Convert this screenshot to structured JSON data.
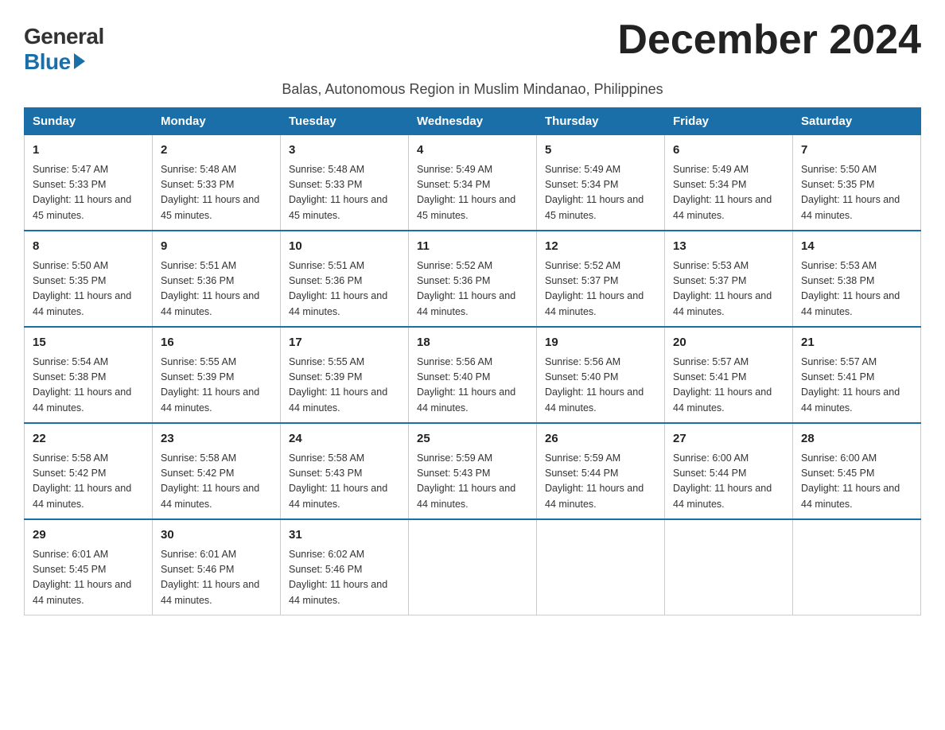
{
  "logo": {
    "general": "General",
    "blue": "Blue"
  },
  "title": "December 2024",
  "subtitle": "Balas, Autonomous Region in Muslim Mindanao, Philippines",
  "headers": [
    "Sunday",
    "Monday",
    "Tuesday",
    "Wednesday",
    "Thursday",
    "Friday",
    "Saturday"
  ],
  "weeks": [
    [
      {
        "day": "1",
        "sunrise": "5:47 AM",
        "sunset": "5:33 PM",
        "daylight": "11 hours and 45 minutes."
      },
      {
        "day": "2",
        "sunrise": "5:48 AM",
        "sunset": "5:33 PM",
        "daylight": "11 hours and 45 minutes."
      },
      {
        "day": "3",
        "sunrise": "5:48 AM",
        "sunset": "5:33 PM",
        "daylight": "11 hours and 45 minutes."
      },
      {
        "day": "4",
        "sunrise": "5:49 AM",
        "sunset": "5:34 PM",
        "daylight": "11 hours and 45 minutes."
      },
      {
        "day": "5",
        "sunrise": "5:49 AM",
        "sunset": "5:34 PM",
        "daylight": "11 hours and 45 minutes."
      },
      {
        "day": "6",
        "sunrise": "5:49 AM",
        "sunset": "5:34 PM",
        "daylight": "11 hours and 44 minutes."
      },
      {
        "day": "7",
        "sunrise": "5:50 AM",
        "sunset": "5:35 PM",
        "daylight": "11 hours and 44 minutes."
      }
    ],
    [
      {
        "day": "8",
        "sunrise": "5:50 AM",
        "sunset": "5:35 PM",
        "daylight": "11 hours and 44 minutes."
      },
      {
        "day": "9",
        "sunrise": "5:51 AM",
        "sunset": "5:36 PM",
        "daylight": "11 hours and 44 minutes."
      },
      {
        "day": "10",
        "sunrise": "5:51 AM",
        "sunset": "5:36 PM",
        "daylight": "11 hours and 44 minutes."
      },
      {
        "day": "11",
        "sunrise": "5:52 AM",
        "sunset": "5:36 PM",
        "daylight": "11 hours and 44 minutes."
      },
      {
        "day": "12",
        "sunrise": "5:52 AM",
        "sunset": "5:37 PM",
        "daylight": "11 hours and 44 minutes."
      },
      {
        "day": "13",
        "sunrise": "5:53 AM",
        "sunset": "5:37 PM",
        "daylight": "11 hours and 44 minutes."
      },
      {
        "day": "14",
        "sunrise": "5:53 AM",
        "sunset": "5:38 PM",
        "daylight": "11 hours and 44 minutes."
      }
    ],
    [
      {
        "day": "15",
        "sunrise": "5:54 AM",
        "sunset": "5:38 PM",
        "daylight": "11 hours and 44 minutes."
      },
      {
        "day": "16",
        "sunrise": "5:55 AM",
        "sunset": "5:39 PM",
        "daylight": "11 hours and 44 minutes."
      },
      {
        "day": "17",
        "sunrise": "5:55 AM",
        "sunset": "5:39 PM",
        "daylight": "11 hours and 44 minutes."
      },
      {
        "day": "18",
        "sunrise": "5:56 AM",
        "sunset": "5:40 PM",
        "daylight": "11 hours and 44 minutes."
      },
      {
        "day": "19",
        "sunrise": "5:56 AM",
        "sunset": "5:40 PM",
        "daylight": "11 hours and 44 minutes."
      },
      {
        "day": "20",
        "sunrise": "5:57 AM",
        "sunset": "5:41 PM",
        "daylight": "11 hours and 44 minutes."
      },
      {
        "day": "21",
        "sunrise": "5:57 AM",
        "sunset": "5:41 PM",
        "daylight": "11 hours and 44 minutes."
      }
    ],
    [
      {
        "day": "22",
        "sunrise": "5:58 AM",
        "sunset": "5:42 PM",
        "daylight": "11 hours and 44 minutes."
      },
      {
        "day": "23",
        "sunrise": "5:58 AM",
        "sunset": "5:42 PM",
        "daylight": "11 hours and 44 minutes."
      },
      {
        "day": "24",
        "sunrise": "5:58 AM",
        "sunset": "5:43 PM",
        "daylight": "11 hours and 44 minutes."
      },
      {
        "day": "25",
        "sunrise": "5:59 AM",
        "sunset": "5:43 PM",
        "daylight": "11 hours and 44 minutes."
      },
      {
        "day": "26",
        "sunrise": "5:59 AM",
        "sunset": "5:44 PM",
        "daylight": "11 hours and 44 minutes."
      },
      {
        "day": "27",
        "sunrise": "6:00 AM",
        "sunset": "5:44 PM",
        "daylight": "11 hours and 44 minutes."
      },
      {
        "day": "28",
        "sunrise": "6:00 AM",
        "sunset": "5:45 PM",
        "daylight": "11 hours and 44 minutes."
      }
    ],
    [
      {
        "day": "29",
        "sunrise": "6:01 AM",
        "sunset": "5:45 PM",
        "daylight": "11 hours and 44 minutes."
      },
      {
        "day": "30",
        "sunrise": "6:01 AM",
        "sunset": "5:46 PM",
        "daylight": "11 hours and 44 minutes."
      },
      {
        "day": "31",
        "sunrise": "6:02 AM",
        "sunset": "5:46 PM",
        "daylight": "11 hours and 44 minutes."
      },
      null,
      null,
      null,
      null
    ]
  ]
}
